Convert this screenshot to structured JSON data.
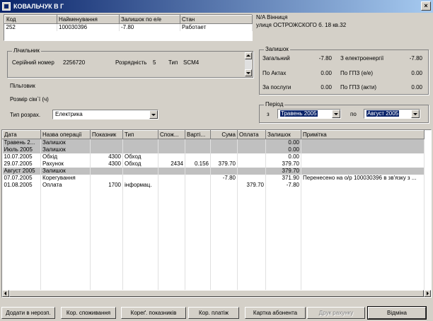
{
  "window": {
    "title": "КОВАЛЬЧУК В Г"
  },
  "top_grid": {
    "columns": [
      "Код",
      "Найменування",
      "Залишок по е/е",
      "Стан"
    ],
    "rows": [
      [
        "252",
        "100030396",
        "-7.80",
        "Работает"
      ]
    ]
  },
  "address": {
    "line1": "N/A Вінниця",
    "line2": "улиця ОСТРОЖСКОГО б. 18 кв.32"
  },
  "meter": {
    "group_title": "Лічильник",
    "serial_label": "Серійний номер",
    "serial_value": "2256720",
    "digits_label": "Розрядність",
    "digits_value": "5",
    "type_label": "Тип",
    "type_value": "SCM4"
  },
  "benefits": {
    "label": "Пільговик",
    "family_label": "Розмір сім`ї (ч)"
  },
  "calc_type": {
    "label": "Тип розрах.",
    "value": "Електрика"
  },
  "balance": {
    "group_title": "Залишок",
    "rows": [
      {
        "l1": "Загальний",
        "v1": "-7.80",
        "l2": "З електроенергії",
        "v2": "-7.80"
      },
      {
        "l1": "По Актах",
        "v1": "0.00",
        "l2": "По ГПЗ (е/е)",
        "v2": "0.00"
      },
      {
        "l1": "За послуги",
        "v1": "0.00",
        "l2": "По ГПЗ (акти)",
        "v2": "0.00"
      }
    ]
  },
  "period": {
    "group_title": "Період",
    "from_label": "з",
    "from_value": "Травень 2005",
    "to_label": "по",
    "to_value": "Август 2005"
  },
  "main_grid": {
    "columns": [
      "Дата",
      "Назва операції",
      "Показник",
      "Тип",
      "Спож...",
      "Варті...",
      "Сума",
      "Оплата",
      "Залишок",
      "Примітка"
    ],
    "rows": [
      {
        "gray": true,
        "cells": [
          "Травень 2...",
          "Залишок",
          "",
          "",
          "",
          "",
          "",
          "",
          "0.00",
          ""
        ]
      },
      {
        "gray": true,
        "cells": [
          "Июль 2005",
          "Залишок",
          "",
          "",
          "",
          "",
          "",
          "",
          "0.00",
          ""
        ]
      },
      {
        "gray": false,
        "cells": [
          "10.07.2005",
          "Обхід",
          "4300",
          "Обход",
          "",
          "",
          "",
          "",
          "0.00",
          ""
        ]
      },
      {
        "gray": false,
        "cells": [
          "29.07.2005",
          "Рахунок",
          "4300",
          "Обход",
          "2434",
          "0.156",
          "379.70",
          "",
          "379.70",
          ""
        ]
      },
      {
        "gray": true,
        "cells": [
          "Август 2005",
          "Залишок",
          "",
          "",
          "",
          "",
          "",
          "",
          "379.70",
          ""
        ]
      },
      {
        "gray": false,
        "cells": [
          "07.07.2005",
          "Корегування",
          "",
          "",
          "",
          "",
          "-7.80",
          "",
          "371.90",
          "Перенесено на о/р 100030396 в зв'язку з ..."
        ]
      },
      {
        "gray": false,
        "cells": [
          "01.08.2005",
          "Оплата",
          "1700",
          "інформац.",
          "",
          "",
          "",
          "379.70",
          "-7.80",
          ""
        ]
      }
    ]
  },
  "buttons": {
    "add_unknown": "Додати в нерозп.",
    "correct_consumption": "Кор. споживання",
    "correct_readings": "Кореґ. показників",
    "correct_payment": "Кор. платіж",
    "subscriber_card": "Картка абонента",
    "print_invoice": "Друк рахунку",
    "cancel": "Відміна"
  }
}
